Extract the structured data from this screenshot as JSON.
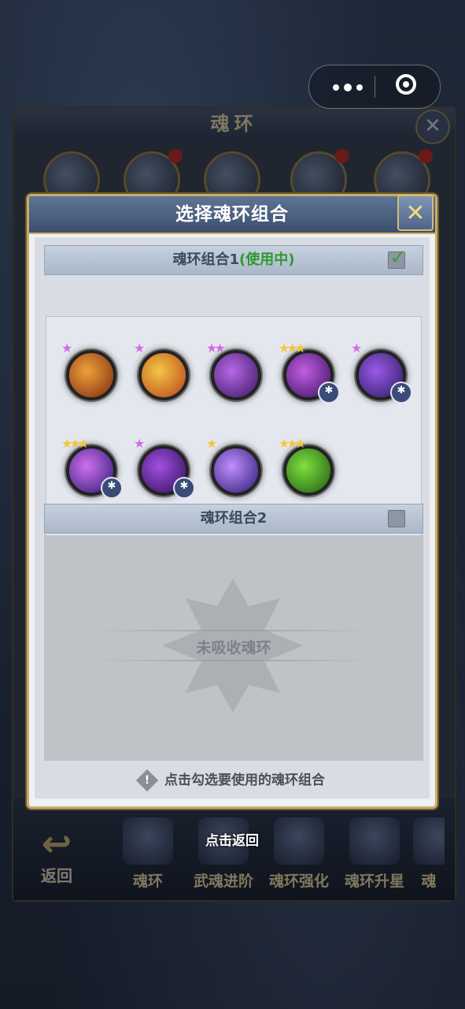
{
  "capsule": {
    "more_label": "more",
    "close_label": "close"
  },
  "background": {
    "title": "魂环",
    "bottom_nav": [
      "魂环",
      "武魂进阶",
      "魂环强化",
      "魂环升星",
      "魂"
    ],
    "back_label": "返回"
  },
  "popup": {
    "title": "选择魂环组合",
    "group1": {
      "title": "魂环组合1",
      "status": "(使用中)",
      "checked": true,
      "rings": [
        {
          "stars": "★",
          "star_color": "purple",
          "colors": [
            "#f0a13a",
            "#7a2a10"
          ],
          "badge": false
        },
        {
          "stars": "★",
          "star_color": "purple",
          "colors": [
            "#f3c845",
            "#b8401a"
          ],
          "badge": false
        },
        {
          "stars": "★★",
          "star_color": "purple",
          "colors": [
            "#b868e8",
            "#3a1660"
          ],
          "badge": false
        },
        {
          "stars": "★★★",
          "star_color": "gold",
          "colors": [
            "#c060e0",
            "#3a1060"
          ],
          "badge": true
        },
        {
          "stars": "★",
          "star_color": "purple",
          "colors": [
            "#9a5ae8",
            "#2a1a60"
          ],
          "badge": true
        },
        {
          "stars": "★★★",
          "star_color": "gold",
          "colors": [
            "#d070f0",
            "#2a1a70"
          ],
          "badge": true
        },
        {
          "stars": "★",
          "star_color": "purple",
          "colors": [
            "#a050e0",
            "#300e58"
          ],
          "badge": true
        },
        {
          "stars": "★",
          "star_color": "gold",
          "colors": [
            "#c090ff",
            "#2a1a70"
          ],
          "badge": false
        },
        {
          "stars": "★★★",
          "star_color": "gold",
          "colors": [
            "#7ee040",
            "#1e5a10"
          ],
          "badge": false
        }
      ]
    },
    "group2": {
      "title": "魂环组合2",
      "checked": false,
      "empty_text": "未吸收魂环"
    },
    "hint": "点击勾选要使用的魂环组合"
  },
  "tap_return": "点击返回"
}
